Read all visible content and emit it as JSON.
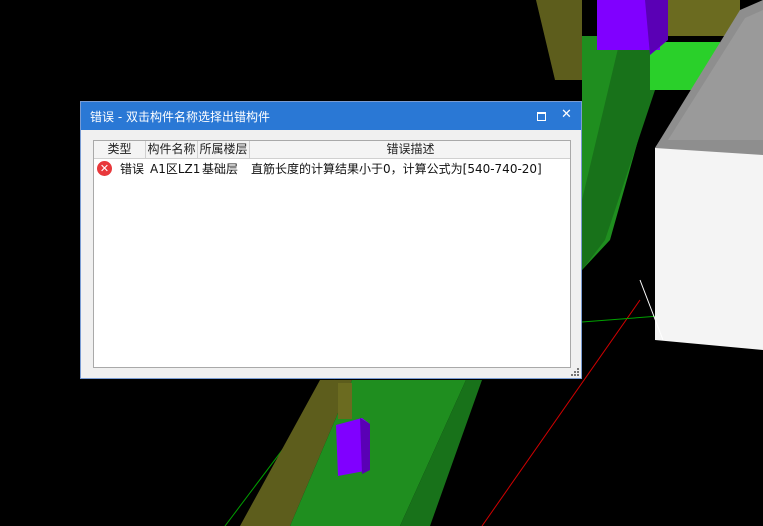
{
  "dialog": {
    "title": "错误 - 双击构件名称选择出错构件",
    "maximize_symbol": "",
    "close_symbol": "✕"
  },
  "table": {
    "columns": [
      "类型",
      "构件名称",
      "所属楼层",
      "错误描述"
    ],
    "rows": [
      {
        "type": "错误",
        "name": "A1区LZ1",
        "floor": "基础层",
        "description": "直筋长度的计算结果小于0，计算公式为[540-740-20]"
      }
    ]
  },
  "colors": {
    "titlebar": "#2a78d5",
    "error_icon": "#e8383b",
    "scene_background": "#000000"
  }
}
